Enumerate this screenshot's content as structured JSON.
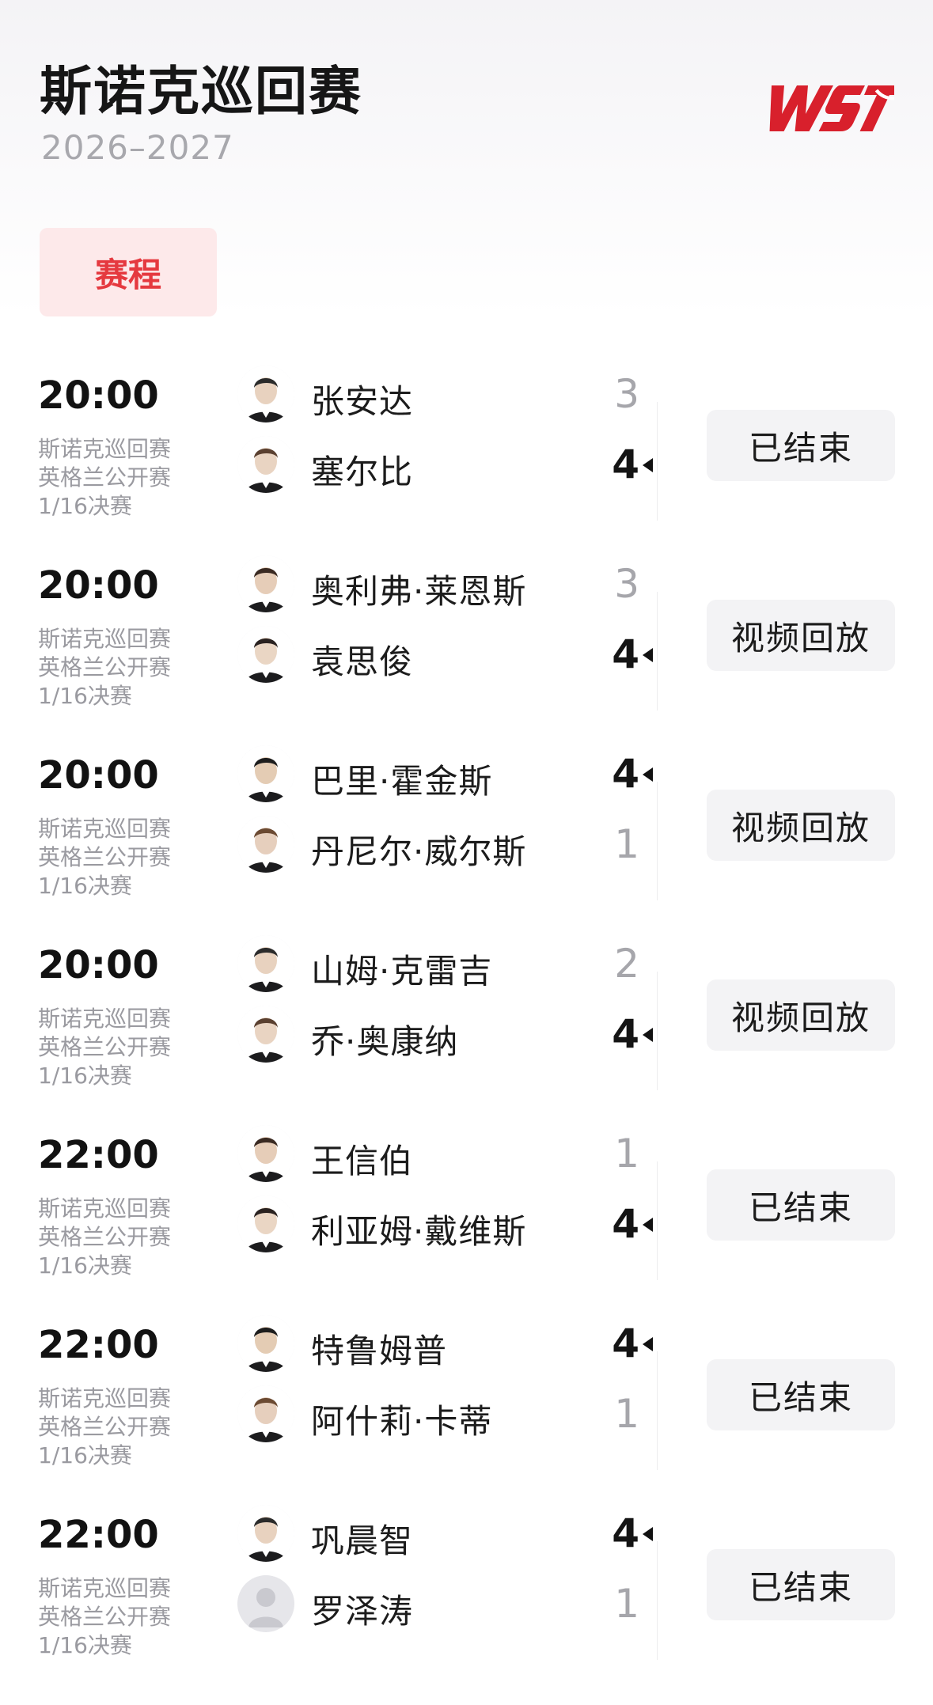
{
  "header": {
    "title": "斯诺克巡回赛",
    "season": "2026–2027",
    "logo_text": "WST",
    "tab_label": "赛程",
    "accent_color": "#e5393f"
  },
  "matches": [
    {
      "time": "20:00",
      "tour": "斯诺克巡回赛",
      "event": "英格兰公开赛",
      "round": "1/16决赛",
      "p1": {
        "name": "张安达",
        "score": "3",
        "winner": false,
        "avatar": "player-photo"
      },
      "p2": {
        "name": "塞尔比",
        "score": "4",
        "winner": true,
        "avatar": "player-photo"
      },
      "status": "已结束"
    },
    {
      "time": "20:00",
      "tour": "斯诺克巡回赛",
      "event": "英格兰公开赛",
      "round": "1/16决赛",
      "p1": {
        "name": "奥利弗·莱恩斯",
        "score": "3",
        "winner": false,
        "avatar": "player-photo"
      },
      "p2": {
        "name": "袁思俊",
        "score": "4",
        "winner": true,
        "avatar": "player-photo"
      },
      "status": "视频回放"
    },
    {
      "time": "20:00",
      "tour": "斯诺克巡回赛",
      "event": "英格兰公开赛",
      "round": "1/16决赛",
      "p1": {
        "name": "巴里·霍金斯",
        "score": "4",
        "winner": true,
        "avatar": "player-photo"
      },
      "p2": {
        "name": "丹尼尔·威尔斯",
        "score": "1",
        "winner": false,
        "avatar": "player-photo"
      },
      "status": "视频回放"
    },
    {
      "time": "20:00",
      "tour": "斯诺克巡回赛",
      "event": "英格兰公开赛",
      "round": "1/16决赛",
      "p1": {
        "name": "山姆·克雷吉",
        "score": "2",
        "winner": false,
        "avatar": "player-photo"
      },
      "p2": {
        "name": "乔·奥康纳",
        "score": "4",
        "winner": true,
        "avatar": "player-photo"
      },
      "status": "视频回放"
    },
    {
      "time": "22:00",
      "tour": "斯诺克巡回赛",
      "event": "英格兰公开赛",
      "round": "1/16决赛",
      "p1": {
        "name": "王信伯",
        "score": "1",
        "winner": false,
        "avatar": "player-photo"
      },
      "p2": {
        "name": "利亚姆·戴维斯",
        "score": "4",
        "winner": true,
        "avatar": "player-photo"
      },
      "status": "已结束"
    },
    {
      "time": "22:00",
      "tour": "斯诺克巡回赛",
      "event": "英格兰公开赛",
      "round": "1/16决赛",
      "p1": {
        "name": "特鲁姆普",
        "score": "4",
        "winner": true,
        "avatar": "player-photo"
      },
      "p2": {
        "name": "阿什莉·卡蒂",
        "score": "1",
        "winner": false,
        "avatar": "player-photo"
      },
      "status": "已结束"
    },
    {
      "time": "22:00",
      "tour": "斯诺克巡回赛",
      "event": "英格兰公开赛",
      "round": "1/16决赛",
      "p1": {
        "name": "巩晨智",
        "score": "4",
        "winner": true,
        "avatar": "player-photo"
      },
      "p2": {
        "name": "罗泽涛",
        "score": "1",
        "winner": false,
        "avatar": "default-avatar"
      },
      "status": "已结束"
    }
  ]
}
